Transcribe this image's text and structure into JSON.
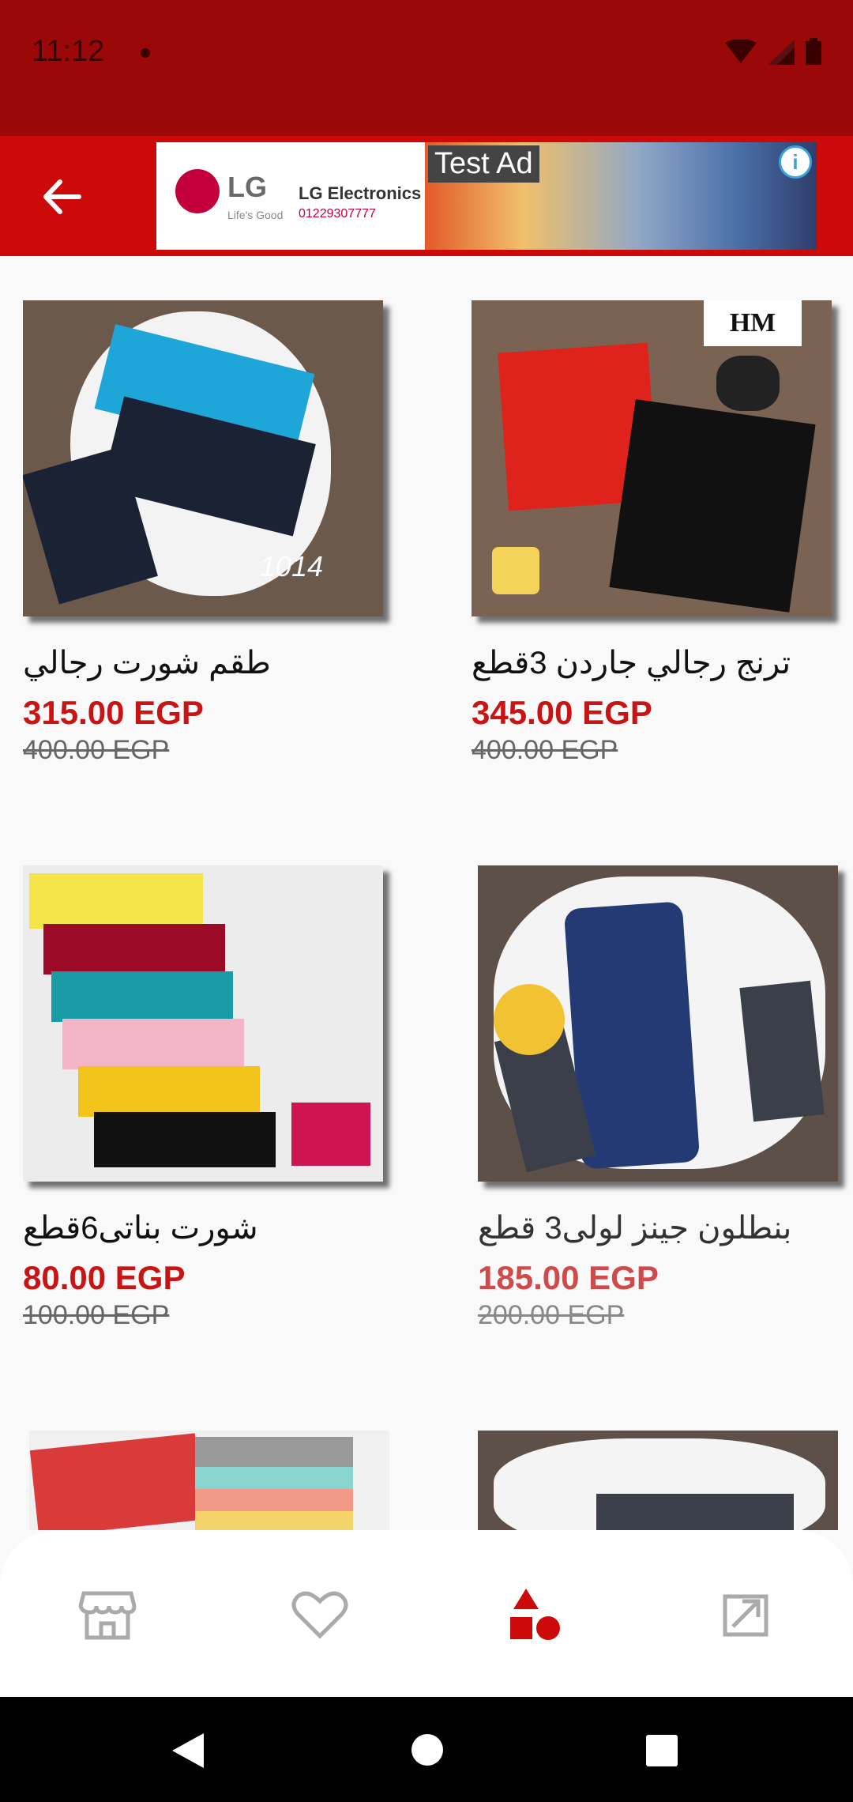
{
  "status_bar": {
    "time": "11:12"
  },
  "header": {
    "back_label": "back",
    "ad": {
      "label": "Test Ad",
      "brand": "LG",
      "slogan": "Life's Good",
      "electronics": "LG Electronics",
      "phone": "01229307777"
    }
  },
  "products": [
    {
      "title": "طقم شورت رجالي",
      "price": "315.00 EGP",
      "old_price": "400.00  EGP",
      "code": "1014"
    },
    {
      "title": "ترنج رجالي جاردن 3قطع",
      "price": "345.00 EGP",
      "old_price": "400.00  EGP",
      "code": "HM"
    },
    {
      "title": "شورت بناتى6قطع",
      "price": "80.00 EGP",
      "old_price": "100.00  EGP"
    },
    {
      "title": "بنطلون جينز لولى3 قطع",
      "price": "185.00 EGP",
      "old_price": "200.00  EGP"
    }
  ],
  "bottom_nav": {
    "items": [
      {
        "icon": "store-icon"
      },
      {
        "icon": "heart-icon"
      },
      {
        "icon": "categories-icon",
        "active": true
      },
      {
        "icon": "logout-icon"
      }
    ]
  },
  "colors": {
    "primary": "#cc0a0a",
    "status": "#9b0808",
    "price": "#c91414"
  }
}
